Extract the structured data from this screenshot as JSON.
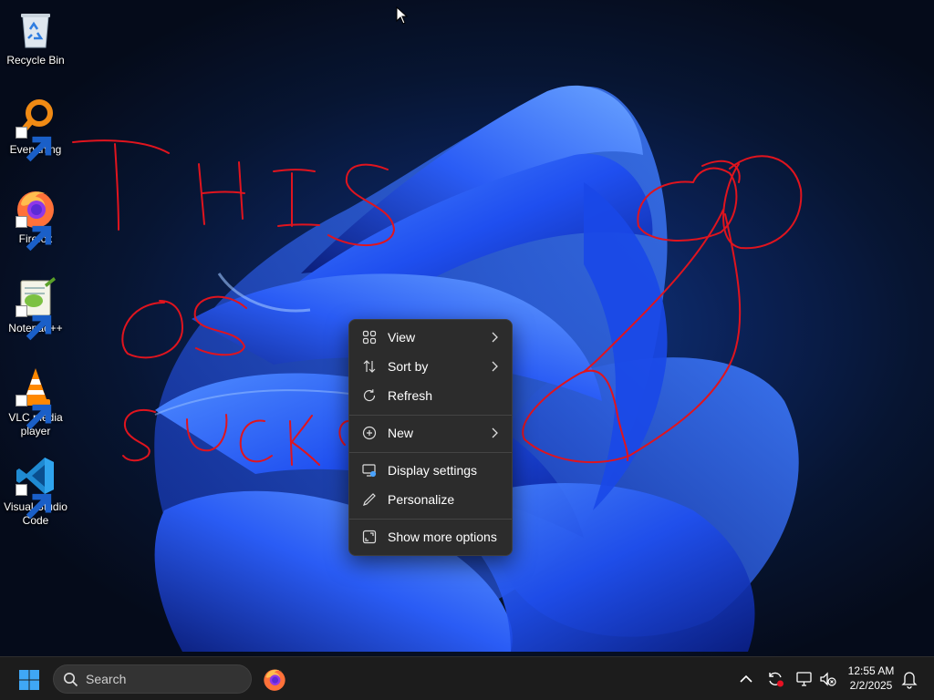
{
  "desktop": {
    "icons": [
      {
        "label": "Recycle Bin",
        "icon": "recycle-bin-icon"
      },
      {
        "label": "Everything",
        "icon": "everything-search-icon"
      },
      {
        "label": "Firefox",
        "icon": "firefox-icon"
      },
      {
        "label": "Notepad++",
        "icon": "notepad-plus-plus-icon"
      },
      {
        "label": "VLC media player",
        "icon": "vlc-icon"
      },
      {
        "label": "Visual Studio Code",
        "icon": "vscode-icon"
      }
    ],
    "handwriting": [
      "THIS",
      "OS",
      "SUCKS"
    ],
    "handwriting_color": "#e0141e"
  },
  "context_menu": {
    "items": [
      {
        "label": "View",
        "icon": "grid-view-icon",
        "submenu": true
      },
      {
        "label": "Sort by",
        "icon": "sort-icon",
        "submenu": true
      },
      {
        "label": "Refresh",
        "icon": "refresh-icon",
        "submenu": false
      },
      {
        "label": "New",
        "icon": "plus-circle-icon",
        "submenu": true
      },
      {
        "label": "Display settings",
        "icon": "display-icon",
        "submenu": false
      },
      {
        "label": "Personalize",
        "icon": "pen-icon",
        "submenu": false
      },
      {
        "label": "Show more options",
        "icon": "expand-icon",
        "submenu": false
      }
    ]
  },
  "taskbar": {
    "search_placeholder": "Search",
    "pinned": [
      "firefox-icon"
    ],
    "tray_icons": [
      "chevron-up-icon",
      "sync-icon",
      "network-icon",
      "volume-muted-icon",
      "bell-icon"
    ],
    "time": "12:55 AM",
    "date": "2/2/2025"
  },
  "colors": {
    "accent": "#0078d4",
    "menu_bg": "#2c2c2c",
    "taskbar_bg": "#1c1c1c"
  }
}
